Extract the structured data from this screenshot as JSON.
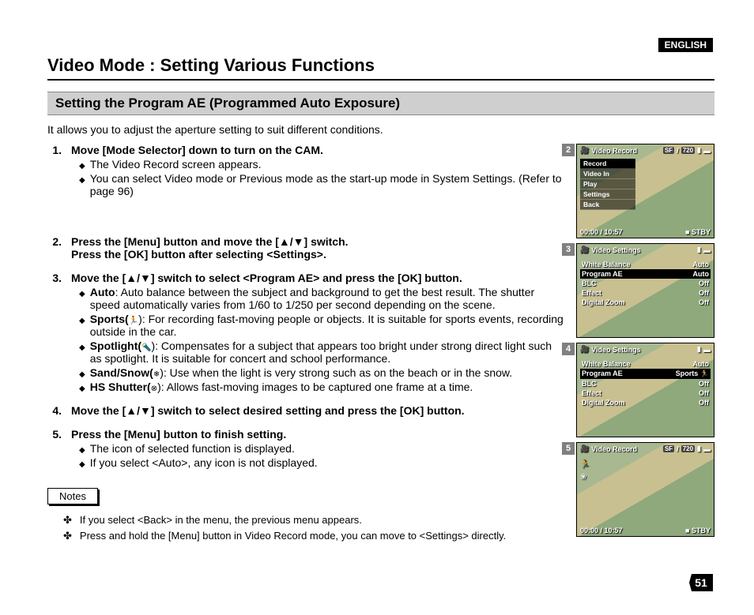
{
  "language_badge": "ENGLISH",
  "page_title": "Video Mode : Setting Various Functions",
  "section_title": "Setting the Program AE (Programmed Auto Exposure)",
  "intro": "It allows you to adjust the aperture setting to suit different conditions.",
  "steps": {
    "s1": {
      "num": "1.",
      "title": "Move [Mode Selector] down to turn on the CAM.",
      "b1": "The Video Record screen appears.",
      "b2": "You can select Video mode or Previous mode as the start-up mode in System Settings. (Refer to page 96)"
    },
    "s2": {
      "num": "2.",
      "title_a": "Press the [Menu] button and move the [",
      "title_b": "] switch.",
      "title_c": "Press the [OK] button after selecting <Settings>."
    },
    "s3": {
      "num": "3.",
      "title_a": "Move the [",
      "title_b": "] switch to select <Program AE> and press the [OK] button.",
      "auto_label": "Auto",
      "auto_text": ": Auto balance between the subject and background to get the best result. The shutter speed automatically varies from 1/60 to 1/250 per second depending on the scene.",
      "sports_label": "Sports(",
      "sports_text": "): For recording fast-moving people or objects. It is suitable for sports events, recording outside in the car.",
      "spot_label": "Spotlight(",
      "spot_text": "): Compensates for a subject that appears too bright under strong direct light such as spotlight. It is suitable for concert and school performance.",
      "sand_label": "Sand/Snow(",
      "sand_text": "): Use when the light is very strong such as on the beach or in the snow.",
      "hs_label": "HS Shutter(",
      "hs_text": "): Allows fast-moving images to be captured one frame at a time."
    },
    "s4": {
      "num": "4.",
      "title_a": "Move the [",
      "title_b": "] switch to select desired setting and press the [OK] button."
    },
    "s5": {
      "num": "5.",
      "title": "Press the [Menu] button to finish setting.",
      "b1": "The icon of selected function is displayed.",
      "b2": "If you select <Auto>, any icon is not displayed."
    }
  },
  "notes_label": "Notes",
  "notes": {
    "n1": "If you select <Back> in the menu, the previous menu appears.",
    "n2": "Press and hold the [Menu] button in Video Record mode, you can move to <Settings> directly."
  },
  "shots": {
    "s2": {
      "num": "2",
      "header": "Video Record",
      "sf": "SF",
      "slash": "/",
      "res": "720",
      "menu0": "Record",
      "menu1": "Video In",
      "menu2": "Play",
      "menu3": "Settings",
      "menu4": "Back",
      "time": "00:00 / 10:57",
      "status": "STBY"
    },
    "s3": {
      "num": "3",
      "header": "Video Settings",
      "r0l": "White Balance",
      "r0r": "Auto",
      "r1l": "Program AE",
      "r1r": "Auto",
      "r2l": "BLC",
      "r2r": "Off",
      "r3l": "Effect",
      "r3r": "Off",
      "r4l": "Digital Zoom",
      "r4r": "Off"
    },
    "s4": {
      "num": "4",
      "header": "Video Settings",
      "r0l": "White Balance",
      "r0r": "Auto",
      "r1l": "Program AE",
      "r1r": "Sports",
      "r2l": "BLC",
      "r2r": "Off",
      "r3l": "Effect",
      "r3r": "Off",
      "r4l": "Digital Zoom",
      "r4r": "Off"
    },
    "s5": {
      "num": "5",
      "header": "Video Record",
      "sf": "SF",
      "slash": "/",
      "res": "720",
      "time": "00:00 / 10:57",
      "status": "STBY"
    }
  },
  "page_number": "51"
}
